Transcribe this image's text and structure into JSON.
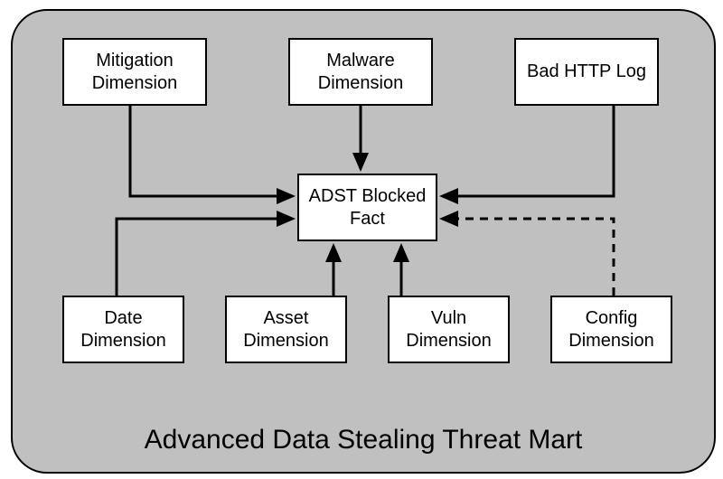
{
  "diagram": {
    "title": "Advanced Data Stealing Threat Mart",
    "nodes": {
      "mitigation": "Mitigation\nDimension",
      "malware": "Malware\nDimension",
      "badhttp": "Bad HTTP Log",
      "fact": "ADST Blocked\nFact",
      "date": "Date\nDimension",
      "asset": "Asset\nDimension",
      "vuln": "Vuln\nDimension",
      "config": "Config\nDimension"
    },
    "edges": [
      {
        "from": "mitigation",
        "to": "fact",
        "style": "solid"
      },
      {
        "from": "malware",
        "to": "fact",
        "style": "solid"
      },
      {
        "from": "badhttp",
        "to": "fact",
        "style": "solid"
      },
      {
        "from": "date",
        "to": "fact",
        "style": "solid"
      },
      {
        "from": "asset",
        "to": "fact",
        "style": "solid"
      },
      {
        "from": "vuln",
        "to": "fact",
        "style": "solid"
      },
      {
        "from": "config",
        "to": "fact",
        "style": "dashed"
      }
    ]
  }
}
